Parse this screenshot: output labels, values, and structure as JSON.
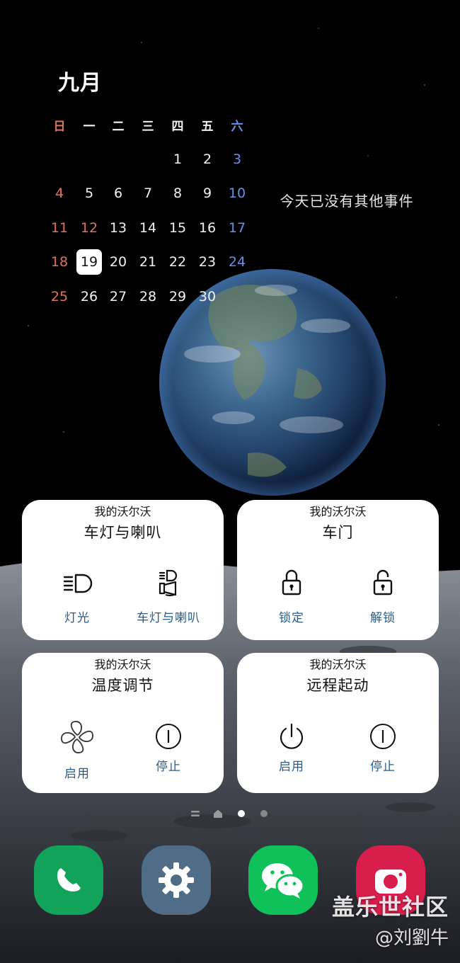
{
  "calendar": {
    "month": "九月",
    "weekdays": [
      "日",
      "一",
      "二",
      "三",
      "四",
      "五",
      "六"
    ],
    "weeks": [
      [
        "",
        "",
        "",
        "",
        "1",
        "2",
        "3"
      ],
      [
        "4",
        "5",
        "6",
        "7",
        "8",
        "9",
        "10"
      ],
      [
        "11",
        "12",
        "13",
        "14",
        "15",
        "16",
        "17"
      ],
      [
        "18",
        "19",
        "20",
        "21",
        "22",
        "23",
        "24"
      ],
      [
        "25",
        "26",
        "27",
        "28",
        "29",
        "30",
        ""
      ]
    ],
    "today": "19",
    "holiday_reds": [
      "12"
    ],
    "no_events": "今天已没有其他事件"
  },
  "widgets": [
    {
      "subtitle": "我的沃尔沃",
      "title": "车灯与喇叭",
      "buttons": [
        {
          "label": "灯光",
          "icon": "headlight-icon"
        },
        {
          "label": "车灯与喇叭",
          "icon": "horn-light-icon"
        }
      ]
    },
    {
      "subtitle": "我的沃尔沃",
      "title": "车门",
      "buttons": [
        {
          "label": "锁定",
          "icon": "lock-icon"
        },
        {
          "label": "解锁",
          "icon": "unlock-icon"
        }
      ]
    },
    {
      "subtitle": "我的沃尔沃",
      "title": "温度调节",
      "buttons": [
        {
          "label": "启用",
          "icon": "fan-icon"
        },
        {
          "label": "停止",
          "icon": "stop-icon"
        }
      ]
    },
    {
      "subtitle": "我的沃尔沃",
      "title": "远程起动",
      "buttons": [
        {
          "label": "启用",
          "icon": "power-icon"
        },
        {
          "label": "停止",
          "icon": "stop-icon"
        }
      ]
    }
  ],
  "page_indicator": {
    "pages": 2,
    "current": 1
  },
  "dock": [
    {
      "name": "phone",
      "icon": "phone-icon",
      "color": "#12a35b"
    },
    {
      "name": "settings",
      "icon": "gear-icon",
      "color": "#4f6d87"
    },
    {
      "name": "wechat",
      "icon": "wechat-icon",
      "color": "#10c15a"
    },
    {
      "name": "camera",
      "icon": "camera-icon",
      "color": "#d81e4c"
    }
  ],
  "watermark": {
    "site": "盖乐世社区",
    "author": "@刘劉牛"
  }
}
